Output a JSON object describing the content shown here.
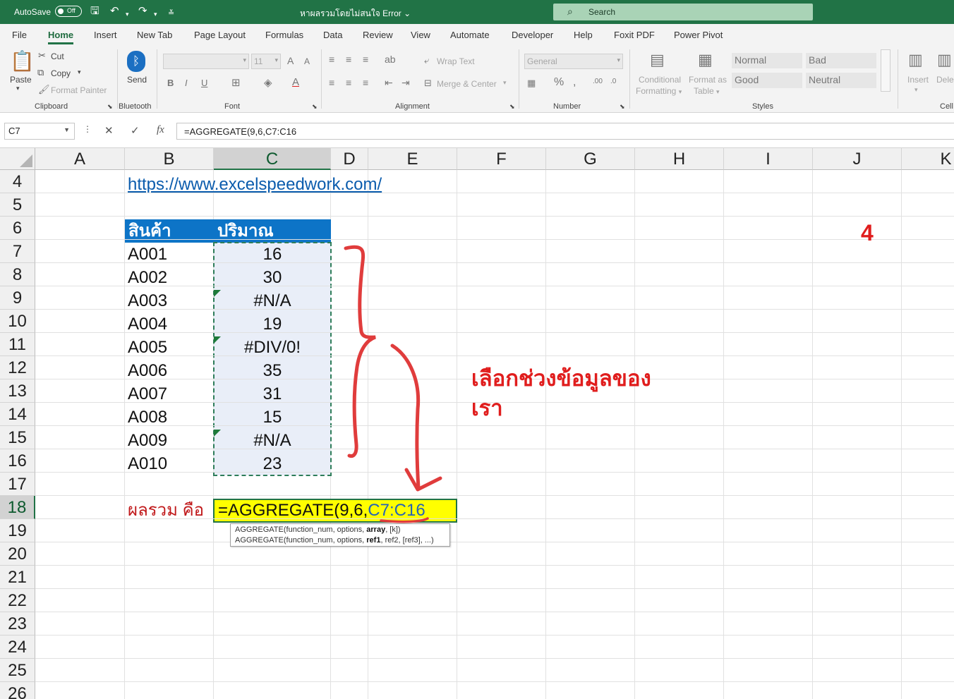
{
  "title_bar": {
    "autosave_label": "AutoSave",
    "autosave_state": "Off",
    "document_title": "หาผลรวมโดยไม่สนใจ Error",
    "search_placeholder": "Search"
  },
  "menu_tabs": [
    "File",
    "Home",
    "Insert",
    "New Tab",
    "Page Layout",
    "Formulas",
    "Data",
    "Review",
    "View",
    "Automate",
    "Developer",
    "Help",
    "Foxit PDF",
    "Power Pivot"
  ],
  "active_tab": "Home",
  "ribbon": {
    "clipboard": {
      "paste": "Paste",
      "cut": "Cut",
      "copy": "Copy",
      "format_painter": "Format Painter",
      "label": "Clipboard"
    },
    "bluetooth": {
      "send": "Send",
      "label": "Bluetooth"
    },
    "font": {
      "size": "11",
      "bold": "B",
      "italic": "I",
      "underline": "U",
      "label": "Font"
    },
    "alignment": {
      "wrap_text": "Wrap Text",
      "merge_center": "Merge & Center",
      "label": "Alignment"
    },
    "number": {
      "format": "General",
      "label": "Number"
    },
    "styles": {
      "conditional_formatting": [
        "Conditional",
        "Formatting"
      ],
      "format_as_table": [
        "Format as",
        "Table"
      ],
      "normal": "Normal",
      "bad": "Bad",
      "good": "Good",
      "neutral": "Neutral",
      "label": "Styles"
    },
    "cells": {
      "insert": "Insert",
      "delete": "Dele",
      "label": "Cell"
    }
  },
  "formula_bar": {
    "name_box": "C7",
    "cancel": "✕",
    "enter": "✓",
    "fx": "fx",
    "formula": "=AGGREGATE(9,6,C7:C16"
  },
  "columns": [
    "A",
    "B",
    "C",
    "D",
    "E",
    "F",
    "G",
    "H",
    "I",
    "J",
    "K"
  ],
  "rows": [
    "4",
    "5",
    "6",
    "7",
    "8",
    "9",
    "10",
    "11",
    "12",
    "13",
    "14",
    "15",
    "16",
    "17",
    "18",
    "19",
    "20",
    "21",
    "22",
    "23",
    "24",
    "25",
    "26"
  ],
  "sheet": {
    "link": "https://www.excelspeedwork.com/",
    "header_product": "สินค้า",
    "header_qty": "ปริมาณ",
    "products": [
      "A001",
      "A002",
      "A003",
      "A004",
      "A005",
      "A006",
      "A007",
      "A008",
      "A009",
      "A010"
    ],
    "quantities": [
      "16",
      "30",
      "#N/A",
      "19",
      "#DIV/0!",
      "35",
      "31",
      "15",
      "#N/A",
      "23"
    ],
    "sum_label": "ผลรวม คือ",
    "edit_formula_prefix": "=AGGREGATE(9,6,",
    "edit_formula_range": "C7:C16"
  },
  "tooltip": {
    "line1": [
      "AGGREGATE(function_num, options, ",
      "array",
      ", [k])"
    ],
    "line2": [
      "AGGREGATE(function_num, options, ",
      "ref1",
      ", ref2, [ref3], ...)"
    ]
  },
  "annotations": {
    "step_number": "4",
    "note_line1": "เลือกช่วงข้อมูลของ",
    "note_line2": "เรา"
  },
  "colors": {
    "excel_green": "#217346",
    "header_blue": "#0d74c7",
    "annotation_red": "#e01d1d",
    "edit_yellow": "#ffff00"
  }
}
